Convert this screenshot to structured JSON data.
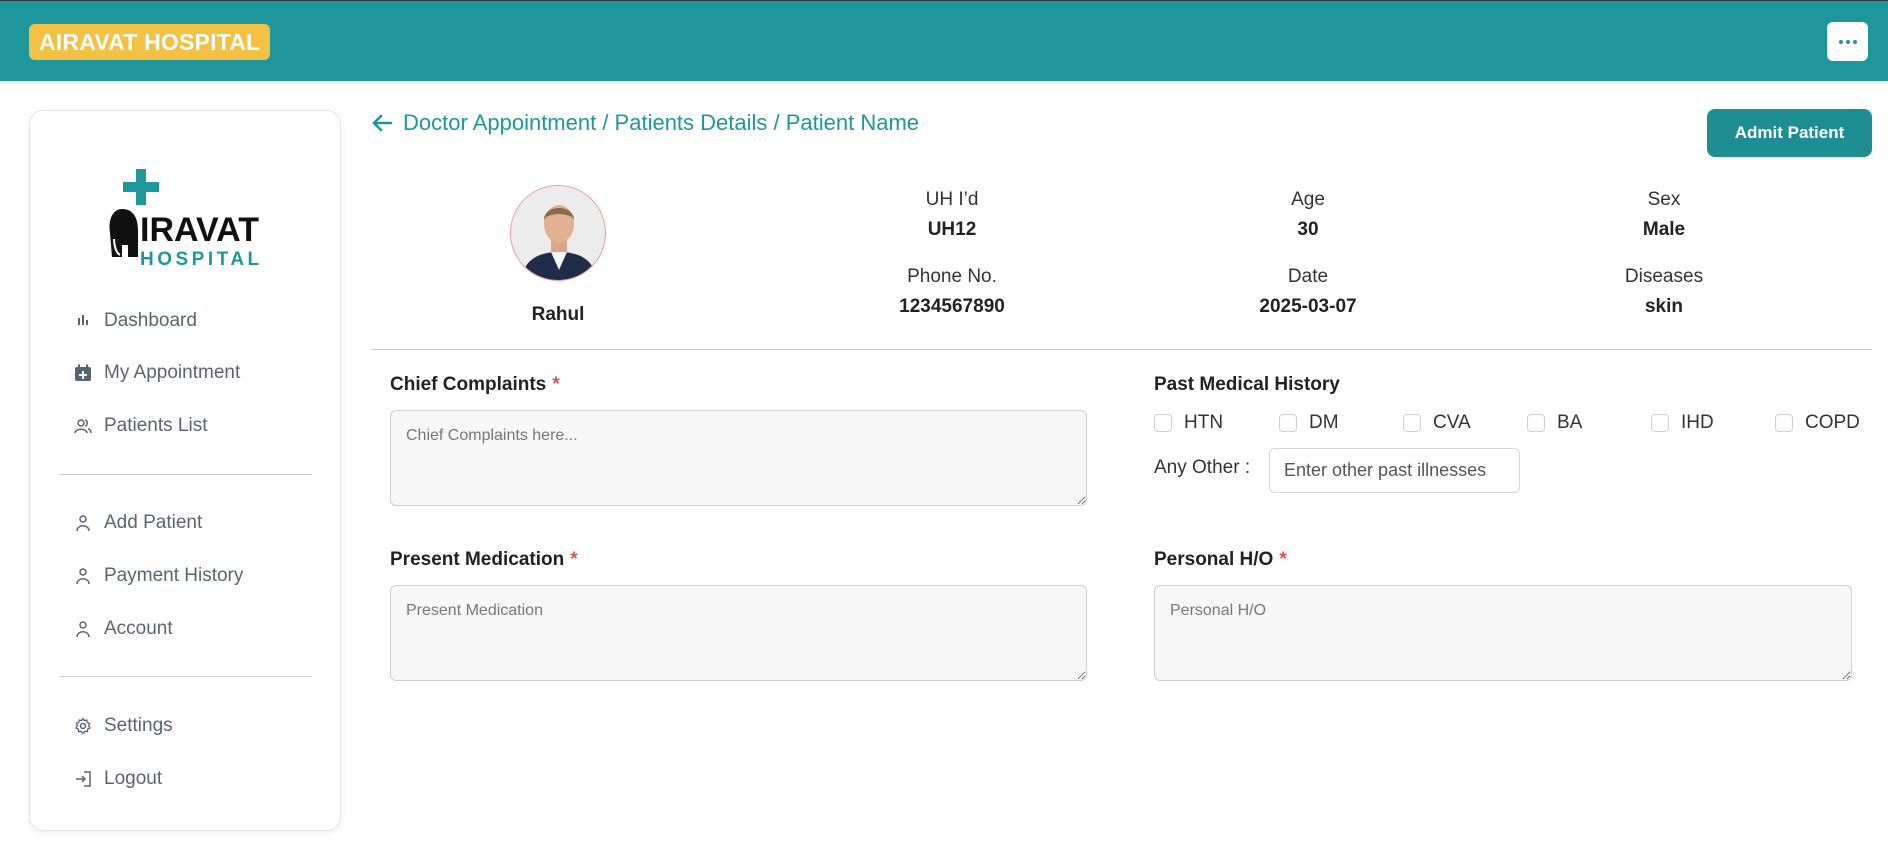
{
  "header": {
    "brand": "AIRAVAT HOSPITAL",
    "menu_icon": "ellipsis-icon"
  },
  "logo": {
    "line1": "IRAVAT",
    "line2": "HOSPITAL"
  },
  "sidebar": {
    "items": [
      {
        "label": "Dashboard",
        "icon": "bar-chart-icon"
      },
      {
        "label": "My Appointment",
        "icon": "calendar-plus-icon"
      },
      {
        "label": "Patients List",
        "icon": "users-icon"
      },
      {
        "label": "Add Patient",
        "icon": "user-icon"
      },
      {
        "label": "Payment History",
        "icon": "user-icon"
      },
      {
        "label": "Account",
        "icon": "user-icon"
      },
      {
        "label": "Settings",
        "icon": "gear-icon"
      },
      {
        "label": "Logout",
        "icon": "logout-icon"
      }
    ]
  },
  "breadcrumb": {
    "text": "Doctor Appointment / Patients Details / Patient Name"
  },
  "actions": {
    "admit_label": "Admit Patient"
  },
  "patient": {
    "name": "Rahul",
    "fields": [
      {
        "label": "UH I’d",
        "value": "UH12"
      },
      {
        "label": "Age",
        "value": "30"
      },
      {
        "label": "Sex",
        "value": "Male"
      },
      {
        "label": "Phone No.",
        "value": "1234567890"
      },
      {
        "label": "Date",
        "value": "2025-03-07"
      },
      {
        "label": "Diseases",
        "value": "skin"
      }
    ]
  },
  "form": {
    "chief_complaints": {
      "label": "Chief Complaints",
      "required": "*",
      "placeholder": "Chief Complaints here..."
    },
    "present_medication": {
      "label": "Present Medication",
      "required": "*",
      "placeholder": "Present Medication"
    },
    "personal_ho": {
      "label": "Personal H/O",
      "required": "*",
      "placeholder": "Personal H/O"
    },
    "past_history": {
      "label": "Past Medical History",
      "options": [
        "HTN",
        "DM",
        "CVA",
        "BA",
        "IHD",
        "COPD"
      ],
      "any_other_label": "Any Other :",
      "any_other_placeholder": "Enter other past illnesses"
    }
  },
  "colors": {
    "primary": "#1e969b",
    "brand_badge": "#f3c143",
    "required": "#d9534f"
  }
}
